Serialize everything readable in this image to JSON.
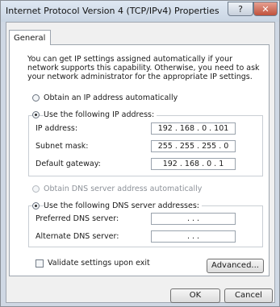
{
  "window": {
    "title": "Internet Protocol Version 4 (TCP/IPv4) Properties",
    "help_label": "?",
    "close_label": "✕"
  },
  "tabs": [
    {
      "label": "General"
    }
  ],
  "description": "You can get IP settings assigned automatically if your network supports this capability. Otherwise, you need to ask your network administrator for the appropriate IP settings.",
  "ip": {
    "auto_label": "Obtain an IP address automatically",
    "manual_label": "Use the following IP address:",
    "selected": "manual",
    "fields": [
      {
        "label": "IP address:",
        "value": "192 . 168 .  0  . 101"
      },
      {
        "label": "Subnet mask:",
        "value": "255 . 255 . 255 .  0"
      },
      {
        "label": "Default gateway:",
        "value": "192 . 168 .  0  .  1"
      }
    ]
  },
  "dns": {
    "auto_label": "Obtain DNS server address automatically",
    "manual_label": "Use the following DNS server addresses:",
    "selected": "manual",
    "fields": [
      {
        "label": "Preferred DNS server:",
        "value": ".        .        ."
      },
      {
        "label": "Alternate DNS server:",
        "value": ".        .        ."
      }
    ]
  },
  "validate_label": "Validate settings upon exit",
  "validate_checked": false,
  "buttons": {
    "advanced": "Advanced...",
    "ok": "OK",
    "cancel": "Cancel"
  }
}
